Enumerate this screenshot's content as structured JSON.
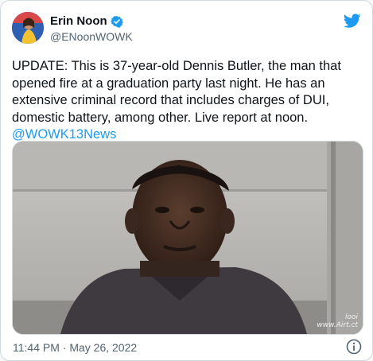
{
  "author": {
    "display_name": "Erin Noon",
    "handle": "@ENoonWOWK",
    "verified_icon": "verified-badge-icon",
    "avatar": "avatar"
  },
  "platform_icon": "twitter-bird-icon",
  "tweet": {
    "text": "UPDATE: This is 37-year-old Dennis Butler, the man that opened fire at a graduation party last night. He has an extensive criminal record that includes charges of DUI, domestic battery, among other. Live report at noon.",
    "mention": "@WOWK13News"
  },
  "media": {
    "watermark_brand": "looi",
    "watermark_url": "www.Airt.ct"
  },
  "footer": {
    "timestamp": "11:44 PM · May 26, 2022",
    "info_icon": "info-icon"
  },
  "colors": {
    "accent": "#1d9bf0",
    "text": "#0f1419",
    "muted": "#536471",
    "border": "#cfd9de"
  }
}
